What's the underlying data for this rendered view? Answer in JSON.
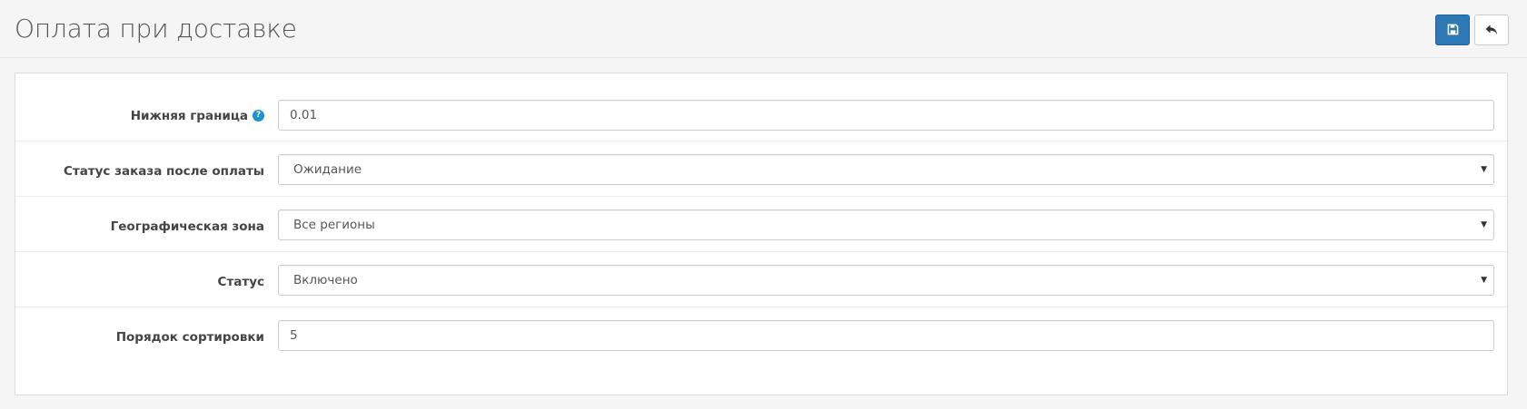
{
  "header": {
    "title": "Оплата при доставке",
    "save_icon": "floppy-disk-icon",
    "back_icon": "reply-arrow-icon",
    "colors": {
      "primary": "#2d78b5",
      "help": "#1e91cf"
    }
  },
  "form": {
    "min_total": {
      "label": "Нижняя граница",
      "value": "0.01",
      "help_icon": "question-circle-icon"
    },
    "order_status": {
      "label": "Статус заказа после оплаты",
      "value": "Ожидание"
    },
    "geo_zone": {
      "label": "Географическая зона",
      "value": "Все регионы"
    },
    "status": {
      "label": "Статус",
      "value": "Включено"
    },
    "sort_order": {
      "label": "Порядок сортировки",
      "value": "5"
    }
  }
}
